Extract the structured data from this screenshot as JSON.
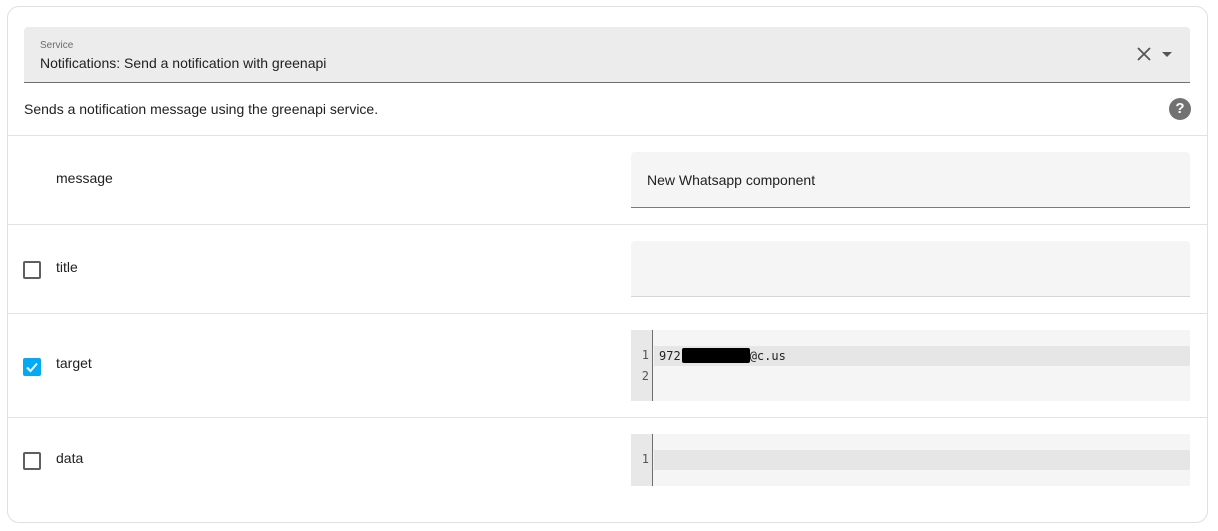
{
  "service": {
    "label": "Service",
    "value": "Notifications: Send a notification with greenapi"
  },
  "description": "Sends a notification message using the greenapi service.",
  "help_icon_glyph": "?",
  "fields": {
    "message": {
      "label": "message",
      "value": "New Whatsapp component"
    },
    "title": {
      "label": "title",
      "checked": false,
      "value": ""
    },
    "target": {
      "label": "target",
      "checked": true,
      "line_numbers": [
        "1",
        "2"
      ],
      "line1_prefix": "972",
      "line1_suffix": "@c.us"
    },
    "data": {
      "label": "data",
      "checked": false,
      "line_numbers": [
        "1"
      ]
    }
  },
  "colors": {
    "accent": "#03a9f4"
  },
  "icons": {
    "clear": "close-icon",
    "dropdown": "caret-down-icon",
    "help": "help-circle-icon",
    "check": "checkmark-icon"
  }
}
